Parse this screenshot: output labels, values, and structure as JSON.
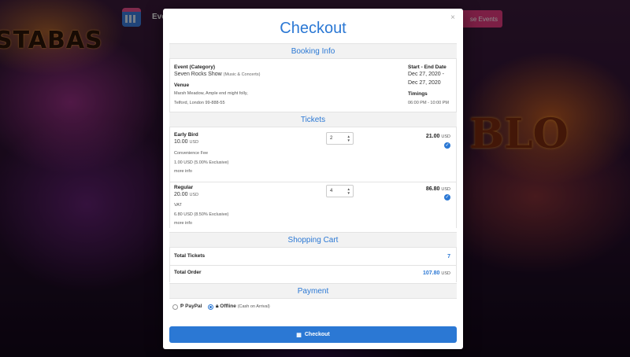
{
  "background": {
    "bg_text": "STABAS",
    "bg_text2": "BLO",
    "brand_icon": "calendar-icon",
    "brand_title": "Eve",
    "nav_button_label": "se Events"
  },
  "modal": {
    "title": "Checkout",
    "close_icon": "×"
  },
  "booking": {
    "heading": "Booking Info",
    "event_label": "Event (Category)",
    "event_name": "Seven Rocks Show",
    "event_category": "(Music & Concerts)",
    "venue_label": "Venue",
    "venue_line1": "Marsh Meadow, Ample end might folly,",
    "venue_line2": "Telford, London 99-888-55",
    "date_label": "Start - End Date",
    "start_date": "Dec 27, 2020 -",
    "end_date": "Dec 27, 2020",
    "timings_label": "Timings",
    "timings": "06:00 PM - 10:00 PM"
  },
  "tickets": {
    "heading": "Tickets",
    "items": [
      {
        "name": "Early Bird",
        "price": "10.00",
        "currency": "USD",
        "fee_label": "Convenience Fee",
        "fee_value": "1.00 USD (5.00% Exclusive)",
        "more": "more info",
        "qty": "2",
        "total": "21.00"
      },
      {
        "name": "Regular",
        "price": "20.00",
        "currency": "USD",
        "fee_label": "VAT",
        "fee_value": "6.80 USD (8.50% Exclusive)",
        "more": "more info",
        "qty": "4",
        "total": "86.80"
      }
    ]
  },
  "cart": {
    "heading": "Shopping Cart",
    "total_tickets_label": "Total Tickets",
    "total_tickets": "7",
    "total_order_label": "Total Order",
    "total_order": "107.80",
    "currency": "USD"
  },
  "payment": {
    "heading": "Payment",
    "paypal_label": "PayPal",
    "offline_label": "Offline",
    "offline_note": "(Cash on Arrival)",
    "selected": "offline"
  },
  "checkout_button": "Checkout",
  "colors": {
    "accent": "#2b78d4",
    "nav_pink": "#e2397f"
  }
}
